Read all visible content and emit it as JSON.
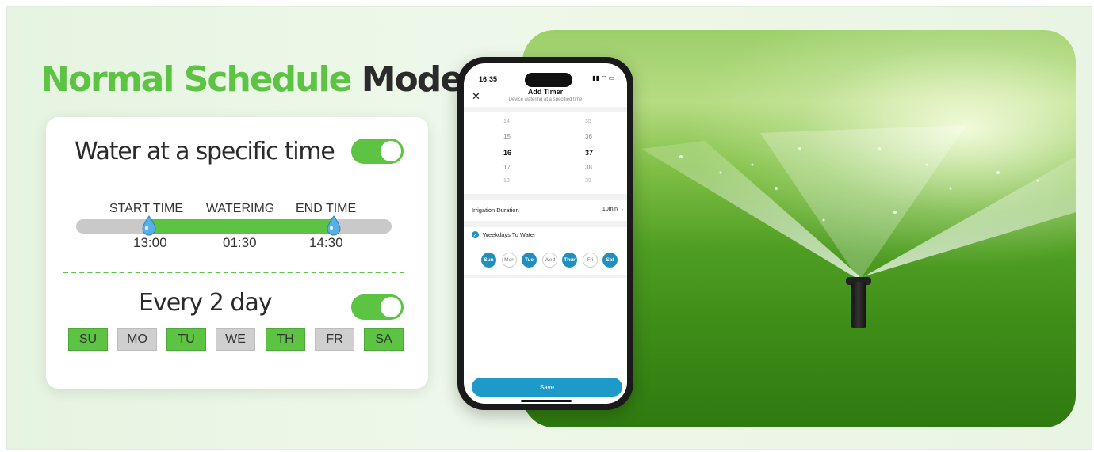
{
  "headline": {
    "green": "Normal Schedule",
    "dark": "Mode"
  },
  "colors": {
    "accent_green": "#5cc343",
    "app_blue": "#1e8fbf",
    "dark_text": "#2b2b2b"
  },
  "card": {
    "title": "Water at a specific time",
    "toggle_on": true,
    "timeline": {
      "start_label": "START TIME",
      "middle_label": "WATERIMG",
      "end_label": "END TIME",
      "start_time": "13:00",
      "duration": "01:30",
      "end_time": "14:30"
    },
    "repeat_title": "Every 2 day",
    "repeat_toggle_on": true,
    "days": [
      {
        "label": "SU",
        "active": true
      },
      {
        "label": "MO",
        "active": false
      },
      {
        "label": "TU",
        "active": true
      },
      {
        "label": "WE",
        "active": false
      },
      {
        "label": "TH",
        "active": true
      },
      {
        "label": "FR",
        "active": false
      },
      {
        "label": "SA",
        "active": true
      }
    ]
  },
  "phone": {
    "status_time": "16:35",
    "title": "Add Timer",
    "subtitle": "Device watering at a specified time",
    "close_icon": "close-icon",
    "picker": {
      "hours": [
        "14",
        "15",
        "16",
        "17",
        "18"
      ],
      "minutes": [
        "35",
        "36",
        "37",
        "38",
        "39"
      ],
      "selected_hour": "16",
      "selected_minute": "37"
    },
    "irrigation_label": "Irrigation Duration",
    "irrigation_value": "10min",
    "weekdays_label": "Weekdays To Water",
    "weekdays": [
      {
        "label": "Sun",
        "active": true
      },
      {
        "label": "Mon",
        "active": false
      },
      {
        "label": "Tue",
        "active": true
      },
      {
        "label": "Wed",
        "active": false
      },
      {
        "label": "Thur",
        "active": true
      },
      {
        "label": "Fri",
        "active": false
      },
      {
        "label": "Sat",
        "active": true
      }
    ],
    "save_label": "Save"
  }
}
